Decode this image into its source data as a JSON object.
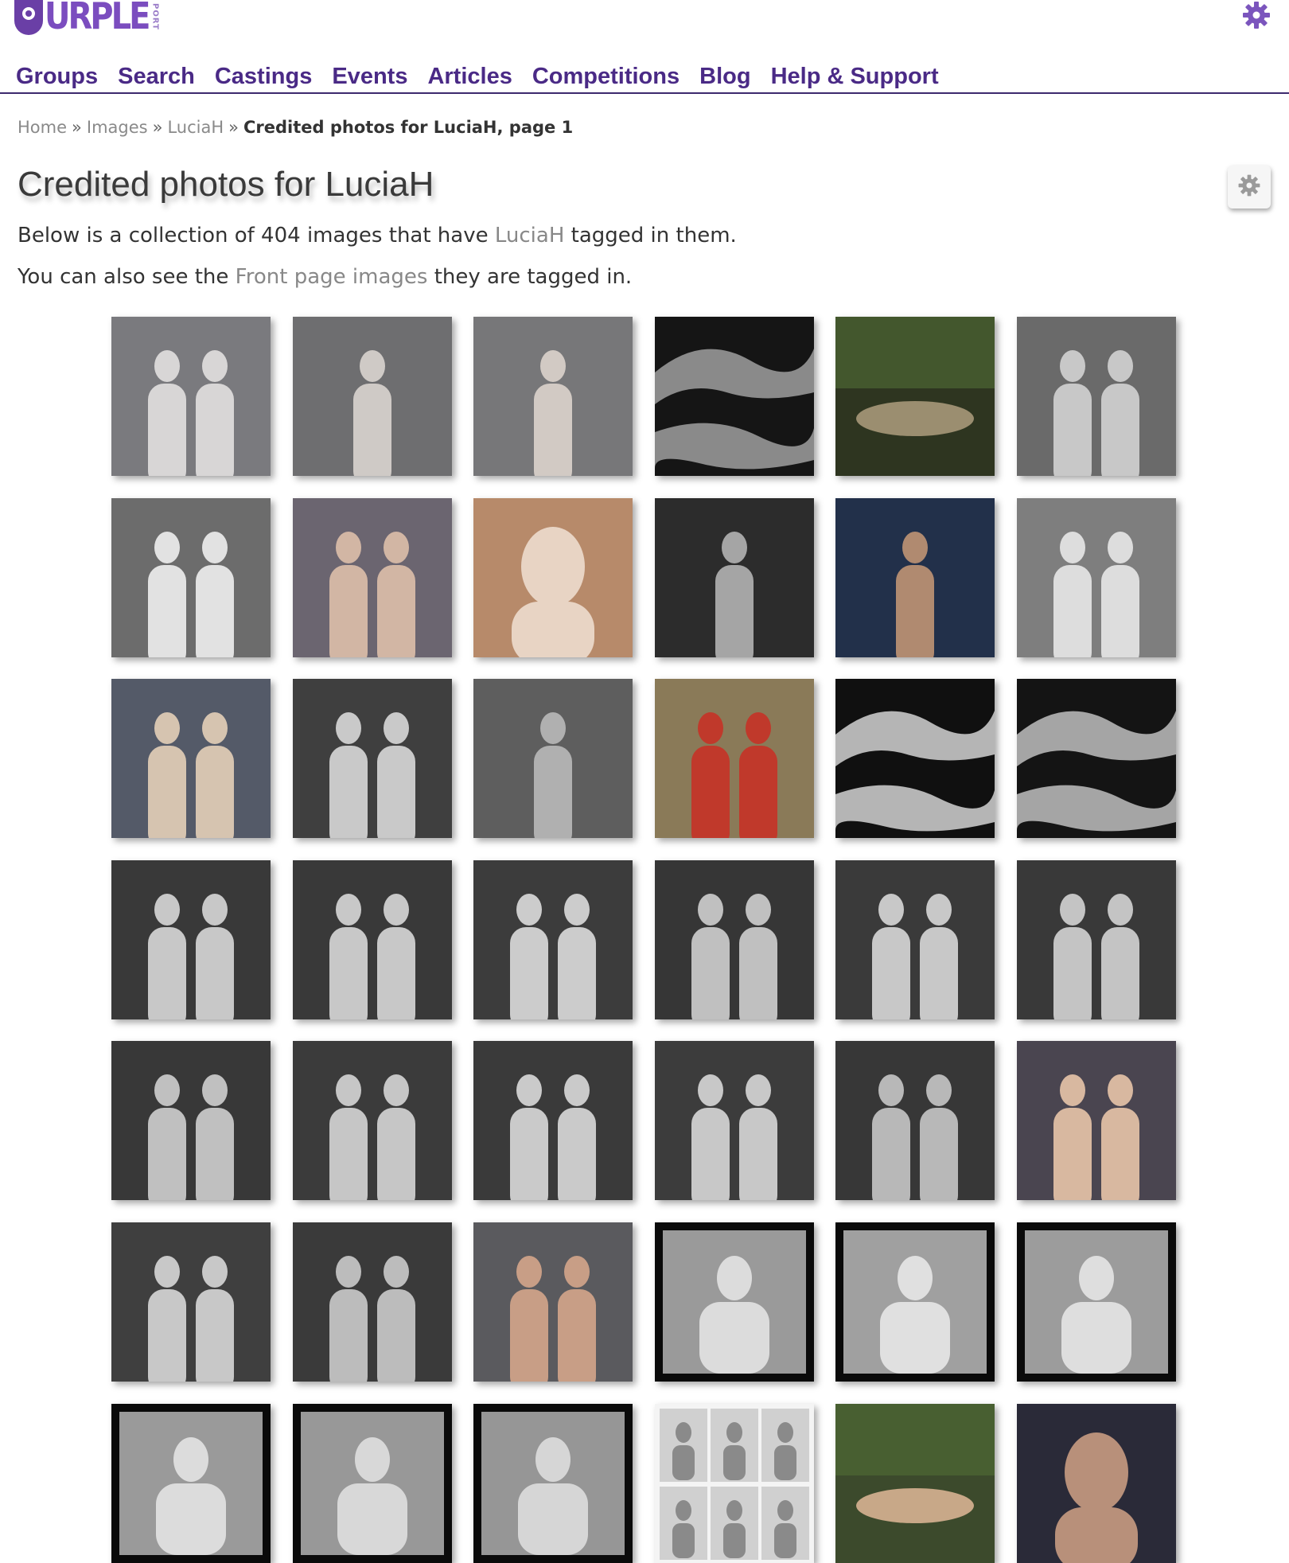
{
  "logo": {
    "text": "URPLE",
    "sub": "PORT"
  },
  "nav": [
    "Groups",
    "Search",
    "Castings",
    "Events",
    "Articles",
    "Competitions",
    "Blog",
    "Help & Support"
  ],
  "breadcrumb": {
    "items": [
      "Home",
      "Images",
      "LuciaH"
    ],
    "separator": "»",
    "current": "Credited photos for LuciaH, page 1"
  },
  "page_title": "Credited photos for LuciaH",
  "intro1": {
    "before": "Below is a collection of 404 images that have ",
    "link": "LuciaH",
    "after": " tagged in them."
  },
  "intro2": {
    "before": "You can also see the ",
    "link": "Front page images",
    "after": " they are tagged in."
  },
  "colors": {
    "brand": "#4a2a86",
    "logo": "#7b4dbf",
    "link_muted": "#888888"
  },
  "icons": {
    "top_right": "gear-icon",
    "settings": "gear-icon"
  },
  "thumbnails": [
    {
      "bg": "#7a7a7e",
      "fg": "#d8d6d6",
      "kind": "duo"
    },
    {
      "bg": "#6e6e70",
      "fg": "#cfcac6",
      "kind": "solo"
    },
    {
      "bg": "#777779",
      "fg": "#d2cac4",
      "kind": "solo"
    },
    {
      "bg": "#151515",
      "fg": "#8a8a8a",
      "kind": "curves"
    },
    {
      "bg": "#2e3520",
      "fg": "#9b8e70",
      "kind": "forest"
    },
    {
      "bg": "#6a6a6a",
      "fg": "#c8c8c8",
      "kind": "duo"
    },
    {
      "bg": "#6c6c6c",
      "fg": "#e2e2e2",
      "kind": "duo"
    },
    {
      "bg": "#6b6570",
      "fg": "#d2b6a4",
      "kind": "duo"
    },
    {
      "bg": "#b78a6a",
      "fg": "#e8d4c4",
      "kind": "portrait"
    },
    {
      "bg": "#2c2c2c",
      "fg": "#a5a5a5",
      "kind": "solo"
    },
    {
      "bg": "#22304a",
      "fg": "#b08a70",
      "kind": "solo"
    },
    {
      "bg": "#7e7e7e",
      "fg": "#dddddd",
      "kind": "duo"
    },
    {
      "bg": "#545a68",
      "fg": "#d6c4b0",
      "kind": "duo"
    },
    {
      "bg": "#3f3f3f",
      "fg": "#c9c9c9",
      "kind": "duo"
    },
    {
      "bg": "#5e5e5e",
      "fg": "#b0b0b0",
      "kind": "solo"
    },
    {
      "bg": "#8a7a58",
      "fg": "#c0392b",
      "kind": "duo"
    },
    {
      "bg": "#101010",
      "fg": "#b5b5b5",
      "kind": "curves"
    },
    {
      "bg": "#141414",
      "fg": "#a5a5a5",
      "kind": "curves"
    },
    {
      "bg": "#393939",
      "fg": "#c8c8c8",
      "kind": "duo"
    },
    {
      "bg": "#393939",
      "fg": "#c8c8c8",
      "kind": "duo"
    },
    {
      "bg": "#3c3c3c",
      "fg": "#cccccc",
      "kind": "duo"
    },
    {
      "bg": "#363636",
      "fg": "#c0c0c0",
      "kind": "duo"
    },
    {
      "bg": "#3a3a3a",
      "fg": "#c8c8c8",
      "kind": "duo"
    },
    {
      "bg": "#393939",
      "fg": "#c4c4c4",
      "kind": "duo"
    },
    {
      "bg": "#383838",
      "fg": "#c0c0c0",
      "kind": "duo"
    },
    {
      "bg": "#3b3b3b",
      "fg": "#c6c6c6",
      "kind": "duo"
    },
    {
      "bg": "#3a3a3a",
      "fg": "#cacaca",
      "kind": "duo"
    },
    {
      "bg": "#3c3c3c",
      "fg": "#c8c8c8",
      "kind": "duo"
    },
    {
      "bg": "#373737",
      "fg": "#b8b8b8",
      "kind": "duo"
    },
    {
      "bg": "#4a4550",
      "fg": "#d8b8a0",
      "kind": "duo"
    },
    {
      "bg": "#3f3f3f",
      "fg": "#c8c8c8",
      "kind": "duo"
    },
    {
      "bg": "#3a3a3a",
      "fg": "#bcbcbc",
      "kind": "duo"
    },
    {
      "bg": "#5a5a5e",
      "fg": "#c89e86",
      "kind": "duo"
    },
    {
      "bg": "#9a9a9a",
      "fg": "#dcdcdc",
      "kind": "framed"
    },
    {
      "bg": "#a0a0a0",
      "fg": "#e0e0e0",
      "kind": "framed"
    },
    {
      "bg": "#9c9c9c",
      "fg": "#dedede",
      "kind": "framed"
    },
    {
      "bg": "#9a9a9a",
      "fg": "#dcdcdc",
      "kind": "framed"
    },
    {
      "bg": "#989898",
      "fg": "#d8d8d8",
      "kind": "framed"
    },
    {
      "bg": "#969696",
      "fg": "#d6d6d6",
      "kind": "framed"
    },
    {
      "bg": "#d0d0d0",
      "fg": "#8a8a8a",
      "kind": "contact"
    },
    {
      "bg": "#3c4a2c",
      "fg": "#c8a888",
      "kind": "forest"
    },
    {
      "bg": "#2a2a38",
      "fg": "#b8907a",
      "kind": "portrait"
    }
  ]
}
